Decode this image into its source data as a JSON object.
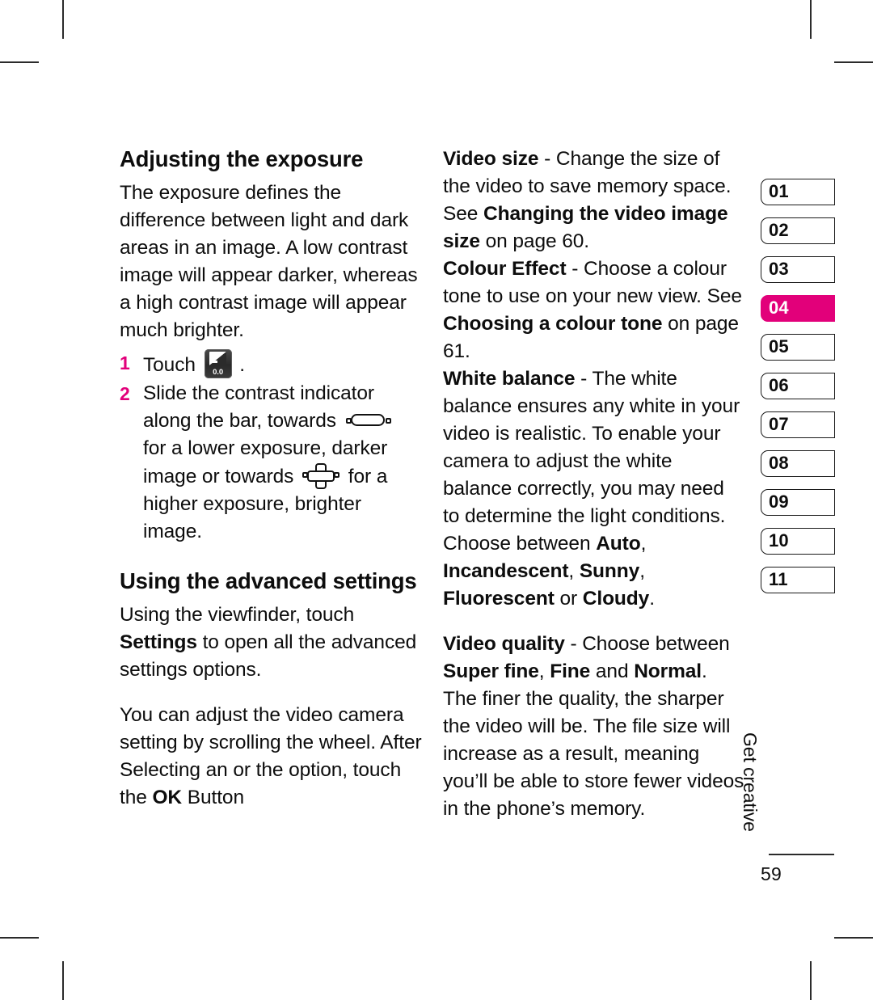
{
  "page": {
    "folio": "59",
    "chapter_label": "Get creative",
    "accent_color": "#E2007A"
  },
  "left_column": {
    "heading_1": "Adjusting the exposure",
    "intro_paragraph": "The exposure defines the difference between light and dark areas in an image. A low contrast image will appear darker, whereas a high contrast image will appear much brighter.",
    "steps": [
      {
        "number": "1",
        "text_before_icon": "Touch ",
        "icon": "exposure-value-icon",
        "icon_value": "0.0",
        "text_after_icon": " ."
      },
      {
        "number": "2",
        "part_1": "Slide the contrast indicator along the bar, towards ",
        "icon_1": "minus-slider-icon",
        "part_2": " for a lower exposure, darker image or towards ",
        "icon_2": "plus-cross-icon",
        "part_3": " for a higher exposure, brighter image."
      }
    ],
    "heading_2": "Using the advanced settings",
    "paragraph_2": {
      "a": "Using the viewfinder, touch ",
      "b_bold": "Settings",
      "c": " to open all the advanced settings options."
    },
    "paragraph_3": {
      "a": "You can adjust the video camera setting by scrolling the wheel. After Selecting an or the option, touch the ",
      "b_bold": "OK",
      "c": " Button"
    }
  },
  "right_column": {
    "video_size": {
      "term": "Video  size",
      "a": " - Change the size of the video to save memory space. See ",
      "b_bold": "Changing the video image size",
      "c": " on page 60."
    },
    "colour_effect": {
      "term": "Colour Effect ",
      "a": " - Choose a colour tone to use on your new view. See ",
      "b_bold": "Choosing a colour tone",
      "c": " on page 61."
    },
    "white_balance": {
      "term": "White balance",
      "a": " - The white balance ensures any white in your video is realistic. To enable your camera to adjust the white balance correctly, you may need to determine the light conditions. Choose between ",
      "opt_1": "Auto",
      "sep_1": ", ",
      "opt_2": "Incandescent",
      "sep_2": ", ",
      "opt_3": "Sunny",
      "sep_3": ", ",
      "opt_4": "Fluorescent",
      "sep_4": " or ",
      "opt_5": "Cloudy",
      "end": "."
    },
    "video_quality": {
      "term": "Video quality",
      "a": " - Choose between ",
      "opt_1": "Super fine",
      "sep_1": ", ",
      "opt_2": "Fine",
      "sep_2": " and ",
      "opt_3": "Normal",
      "b": ". The finer the quality, the sharper the video will be. The file size will increase as a result, meaning you’ll be able to store fewer videos in the phone’s memory."
    }
  },
  "chapter_tabs": [
    {
      "label": "01",
      "active": false
    },
    {
      "label": "02",
      "active": false
    },
    {
      "label": "03",
      "active": false
    },
    {
      "label": "04",
      "active": true
    },
    {
      "label": "05",
      "active": false
    },
    {
      "label": "06",
      "active": false
    },
    {
      "label": "07",
      "active": false
    },
    {
      "label": "08",
      "active": false
    },
    {
      "label": "09",
      "active": false
    },
    {
      "label": "10",
      "active": false
    },
    {
      "label": "11",
      "active": false
    }
  ]
}
